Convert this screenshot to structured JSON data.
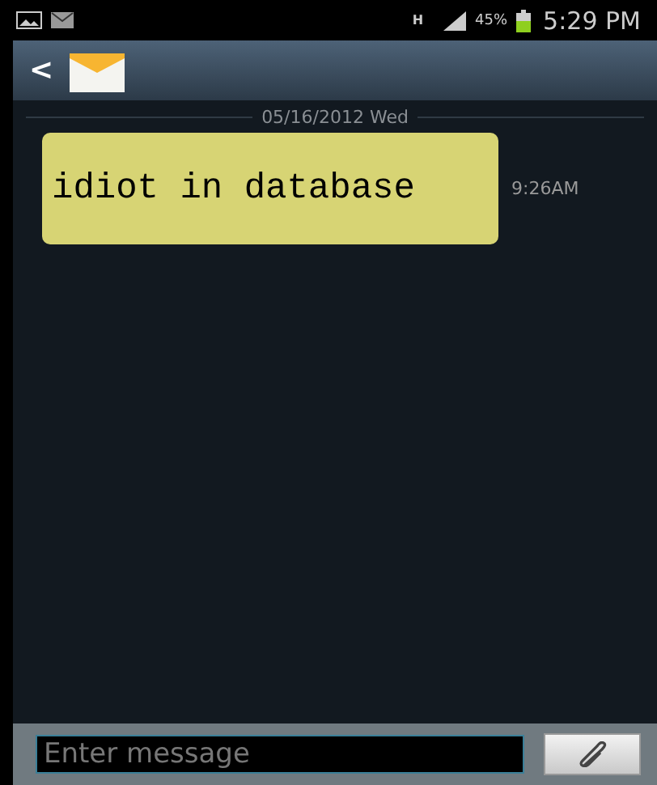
{
  "status_bar": {
    "network": "H",
    "battery": "45%",
    "time": "5:29 PM"
  },
  "header": {
    "back": "<"
  },
  "thread": {
    "date": "05/16/2012 Wed",
    "messages": [
      {
        "text": "idiot in database",
        "time": "9:26AM"
      }
    ]
  },
  "composer": {
    "placeholder": "Enter message"
  }
}
